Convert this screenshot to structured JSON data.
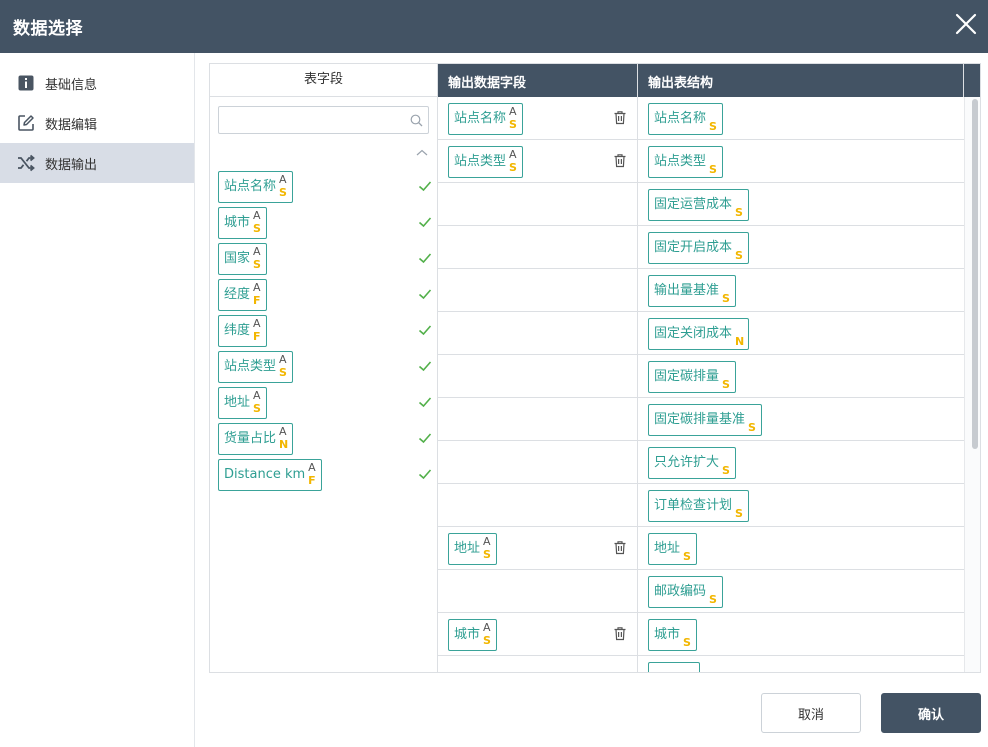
{
  "header": {
    "title": "数据选择"
  },
  "sidebar": {
    "items": [
      {
        "label": "基础信息",
        "icon": "info-icon",
        "active": false
      },
      {
        "label": "数据编辑",
        "icon": "edit-icon",
        "active": false
      },
      {
        "label": "数据输出",
        "icon": "shuffle-icon",
        "active": true
      }
    ]
  },
  "left_panel": {
    "header": "表字段",
    "search": {
      "value": "",
      "placeholder": ""
    },
    "fields": [
      {
        "name": "站点名称",
        "badge_top": "A",
        "badge_type": "S",
        "checked": true
      },
      {
        "name": "城市",
        "badge_top": "A",
        "badge_type": "S",
        "checked": true
      },
      {
        "name": "国家",
        "badge_top": "A",
        "badge_type": "S",
        "checked": true
      },
      {
        "name": "经度",
        "badge_top": "A",
        "badge_type": "F",
        "checked": true
      },
      {
        "name": "纬度",
        "badge_top": "A",
        "badge_type": "F",
        "checked": true
      },
      {
        "name": "站点类型",
        "badge_top": "A",
        "badge_type": "S",
        "checked": true
      },
      {
        "name": "地址",
        "badge_top": "A",
        "badge_type": "S",
        "checked": true
      },
      {
        "name": "货量占比",
        "badge_top": "A",
        "badge_type": "N",
        "checked": true
      },
      {
        "name": "Distance km",
        "badge_top": "A",
        "badge_type": "F",
        "checked": true
      }
    ]
  },
  "grid": {
    "header_output_fields": "输出数据字段",
    "header_output_structure": "输出表结构",
    "rows": [
      {
        "mapped": {
          "name": "站点名称",
          "badge_top": "A",
          "badge_type": "S"
        },
        "target": {
          "name": "站点名称",
          "badge_type": "S"
        }
      },
      {
        "mapped": {
          "name": "站点类型",
          "badge_top": "A",
          "badge_type": "S"
        },
        "target": {
          "name": "站点类型",
          "badge_type": "S"
        }
      },
      {
        "mapped": null,
        "target": {
          "name": "固定运营成本",
          "badge_type": "S"
        }
      },
      {
        "mapped": null,
        "target": {
          "name": "固定开启成本",
          "badge_type": "S"
        }
      },
      {
        "mapped": null,
        "target": {
          "name": "输出量基准",
          "badge_type": "S"
        }
      },
      {
        "mapped": null,
        "target": {
          "name": "固定关闭成本",
          "badge_type": "N"
        }
      },
      {
        "mapped": null,
        "target": {
          "name": "固定碳排量",
          "badge_type": "S"
        }
      },
      {
        "mapped": null,
        "target": {
          "name": "固定碳排量基准",
          "badge_type": "S"
        }
      },
      {
        "mapped": null,
        "target": {
          "name": "只允许扩大",
          "badge_type": "S"
        }
      },
      {
        "mapped": null,
        "target": {
          "name": "订单检查计划",
          "badge_type": "S"
        }
      },
      {
        "mapped": {
          "name": "地址",
          "badge_top": "A",
          "badge_type": "S"
        },
        "target": {
          "name": "地址",
          "badge_type": "S"
        }
      },
      {
        "mapped": null,
        "target": {
          "name": "邮政编码",
          "badge_type": "S"
        }
      },
      {
        "mapped": {
          "name": "城市",
          "badge_top": "A",
          "badge_type": "S"
        },
        "target": {
          "name": "城市",
          "badge_type": "S"
        }
      }
    ]
  },
  "footer": {
    "cancel_label": "取消",
    "confirm_label": "确认"
  },
  "colors": {
    "header_bg": "#435364",
    "accent_teal": "#2e9e92",
    "badge_yellow": "#f2b600",
    "active_nav_bg": "#d8dde6",
    "check_green": "#52b04a"
  }
}
